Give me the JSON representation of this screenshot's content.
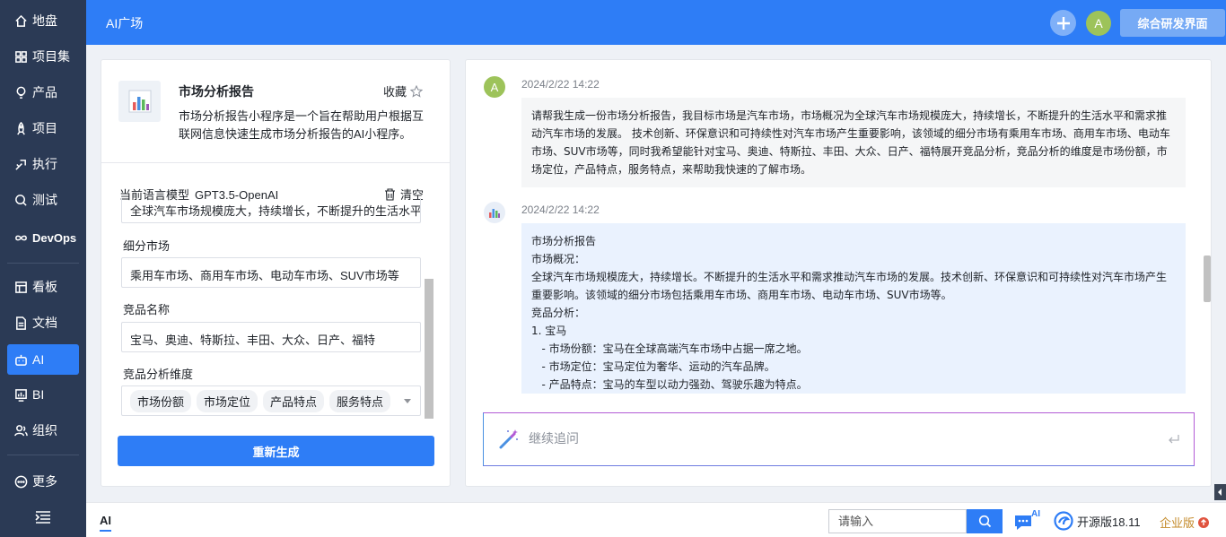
{
  "sidebar": {
    "items": [
      {
        "label": "地盘",
        "icon": "home-icon"
      },
      {
        "label": "项目集",
        "icon": "grid-icon"
      },
      {
        "label": "产品",
        "icon": "lightbulb-icon"
      },
      {
        "label": "项目",
        "icon": "rocket-icon"
      },
      {
        "label": "执行",
        "icon": "sprint-icon"
      },
      {
        "label": "测试",
        "icon": "search-bug-icon"
      },
      {
        "label": "DevOps",
        "icon": "infinity-icon"
      },
      {
        "label": "看板",
        "icon": "kanban-icon"
      },
      {
        "label": "文档",
        "icon": "document-icon"
      },
      {
        "label": "AI",
        "icon": "robot-icon"
      },
      {
        "label": "BI",
        "icon": "chart-icon"
      },
      {
        "label": "组织",
        "icon": "people-icon"
      },
      {
        "label": "更多",
        "icon": "more-icon"
      }
    ],
    "active": "AI"
  },
  "header": {
    "title": "AI广场",
    "avatar_letter": "A",
    "switch_button": "综合研发界面"
  },
  "app": {
    "title": "市场分析报告",
    "favorite_label": "收藏",
    "description": "市场分析报告小程序是一个旨在帮助用户根据互联网信息快速生成市场分析报告的AI小程序。",
    "model_label": "当前语言模型",
    "model_value": "GPT3.5-OpenAI",
    "clear_label": "清空",
    "fields": [
      {
        "label": "",
        "value": "全球汽车市场规模庞大，持续增长，不断提升的生活水平和需求"
      },
      {
        "label": "细分市场",
        "value": "乘用车市场、商用车市场、电动车市场、SUV市场等"
      },
      {
        "label": "竞品名称",
        "value": "宝马、奥迪、特斯拉、丰田、大众、日产、福特"
      }
    ],
    "dimension_label": "竞品分析维度",
    "dimension_tags": [
      "市场份额",
      "市场定位",
      "产品特点",
      "服务特点"
    ],
    "regenerate_button": "重新生成"
  },
  "chat": {
    "messages": [
      {
        "role": "user",
        "avatar": "A",
        "time": "2024/2/22 14:22",
        "text": "请帮我生成一份市场分析报告，我目标市场是汽车市场，市场概况为全球汽车市场规模庞大，持续增长，不断提升的生活水平和需求推动汽车市场的发展。 技术创新、环保意识和可持续性对汽车市场产生重要影响，该领域的细分市场有乘用车市场、商用车市场、电动车市场、SUV市场等，同时我希望能针对宝马、奥迪、特斯拉、丰田、大众、日产、福特展开竞品分析，竞品分析的维度是市场份额，市场定位，产品特点，服务特点，来帮助我快速的了解市场。"
      },
      {
        "role": "ai",
        "time": "2024/2/22 14:22",
        "text": "市场分析报告\n市场概况：\n全球汽车市场规模庞大，持续增长。不断提升的生活水平和需求推动汽车市场的发展。技术创新、环保意识和可持续性对汽车市场产生重要影响。该领域的细分市场包括乘用车市场、商用车市场、电动车市场、SUV市场等。\n竞品分析：\n1. 宝马\n   - 市场份额：宝马在全球高端汽车市场中占据一席之地。\n   - 市场定位：宝马定位为奢华、运动的汽车品牌。\n   - 产品特点：宝马的车型以动力强劲、驾驶乐趣为特点。"
      }
    ],
    "input_placeholder": "继续追问"
  },
  "footer": {
    "tab": "AI",
    "search_placeholder": "请输入",
    "chat_badge": "AI",
    "version": "开源版18.11",
    "enterprise": "企业版"
  },
  "colors": {
    "primary": "#2e7df6",
    "sidebar": "#2b3a55",
    "ai_bubble": "#eaf2fe",
    "user_bubble": "#f5f6f7"
  }
}
